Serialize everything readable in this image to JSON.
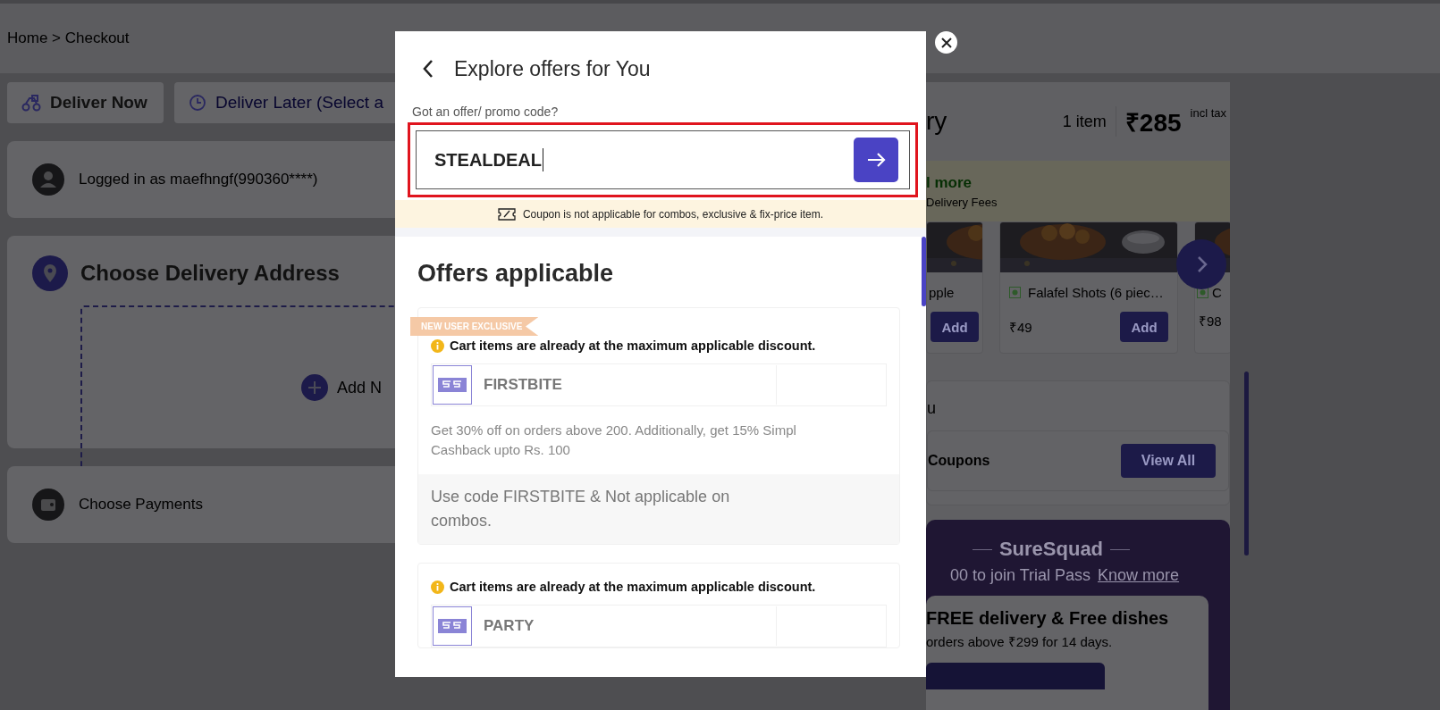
{
  "breadcrumb": "Home > Checkout",
  "delivery_options": [
    {
      "label": "Deliver Now",
      "selected": true,
      "kind": "now"
    },
    {
      "label": "Deliver Later (Select a",
      "selected": false,
      "kind": "later"
    }
  ],
  "login": {
    "text": "Logged in as  maefhngf(990360****)"
  },
  "address": {
    "title": "Choose Delivery Address",
    "add_label": "Add N"
  },
  "payments": {
    "title": "Choose Payments"
  },
  "cart": {
    "title": "ry",
    "count": "1 item",
    "total": "₹285",
    "tax_note": "incl tax",
    "promo": {
      "headline": "l more",
      "subline": "Delivery Fees"
    },
    "items": [
      {
        "name": "pple",
        "add": "Add"
      },
      {
        "name": "Falafel Shots (6 piec…",
        "price": "₹49",
        "add": "Add"
      },
      {
        "name": "C",
        "price": "₹98"
      }
    ]
  },
  "coupons": {
    "heading": "u",
    "label": "Coupons",
    "button": "View All"
  },
  "membership": {
    "title": "SureSquad",
    "line": "00 to join Trial Pass",
    "link": "Know more",
    "headline": "FREE delivery & Free dishes",
    "subline": "orders above ₹299 for 14 days."
  },
  "offers_modal": {
    "title": "Explore offers for You",
    "promo_label": "Got an offer/ promo code?",
    "promo_value": "STEALDEAL",
    "highlighted": true,
    "notice": "Coupon is not applicable for combos, exclusive & fix-price item.",
    "section_title": "Offers applicable",
    "offers": [
      {
        "badge": "NEW USER EXCLUSIVE",
        "warning": "Cart items are already at the maximum applicable discount.",
        "code": "FIRSTBITE",
        "description": "Get 30% off on orders above 200. Additionally, get 15% Simpl Cashback upto Rs. 100",
        "terms": "Use code FIRSTBITE & Not applicable on combos."
      },
      {
        "warning": "Cart items are already at the maximum applicable discount.",
        "code": "PARTY"
      }
    ]
  }
}
